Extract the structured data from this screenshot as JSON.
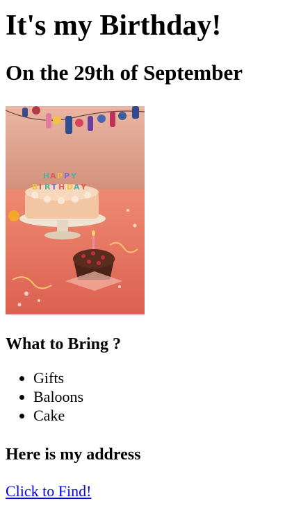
{
  "heading": {
    "title": "It's my Birthday!",
    "date": "On the 29th of September"
  },
  "photo": {
    "icon": "birthday-cake-photo",
    "colors": {
      "wall": "#d99a84",
      "table": "#e56f5b",
      "cake": "#f2c6a2",
      "stand": "#efe4d2"
    }
  },
  "bring": {
    "heading": "What to Bring ?",
    "items": [
      "Gifts",
      "Baloons",
      "Cake"
    ]
  },
  "address": {
    "heading": "Here is my address",
    "link_label": "Click to Find!",
    "link_color": "#0000ee"
  }
}
